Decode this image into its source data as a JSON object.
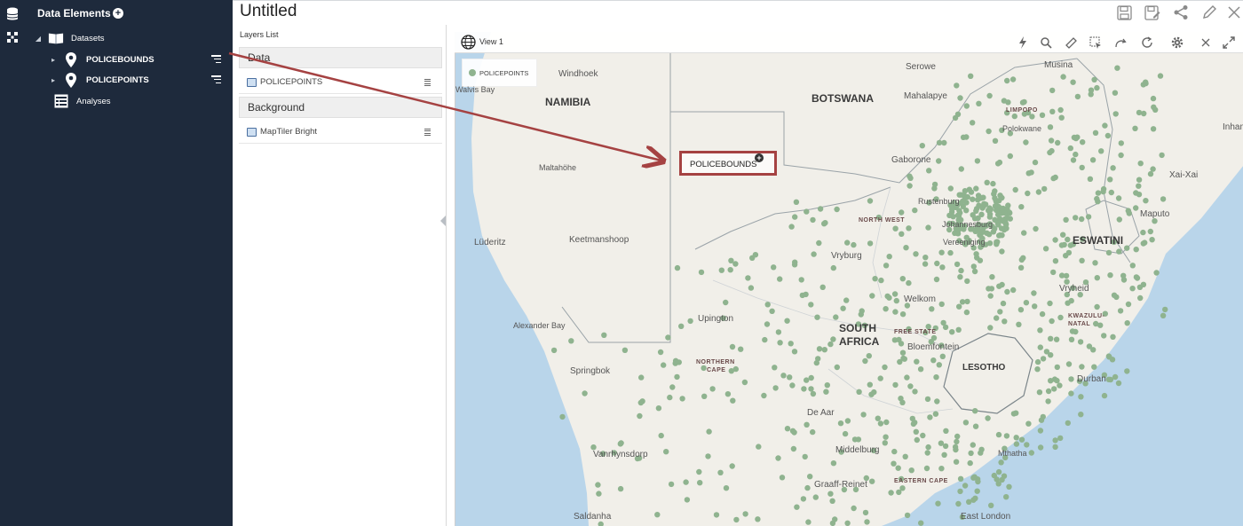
{
  "app": {
    "title": "Untitled"
  },
  "left_panel": {
    "title": "Data Elements",
    "add_icon": "plus-circle-icon",
    "datasets": {
      "label": "Datasets",
      "items": [
        {
          "label": "POLICEBOUNDS",
          "icon": "map-pin-icon"
        },
        {
          "label": "POLICEPOINTS",
          "icon": "map-pin-icon"
        }
      ]
    },
    "analyses": {
      "label": "Analyses"
    },
    "rail_icons": [
      "database-icon",
      "network-icon"
    ]
  },
  "toolbar": {
    "buttons": [
      "save-icon",
      "save-as-icon",
      "share-icon",
      "edit-icon",
      "close-icon"
    ]
  },
  "layers_panel": {
    "title": "Layers List",
    "groups": [
      {
        "label": "Data",
        "layers": [
          {
            "label": "POLICEPOINTS"
          }
        ]
      },
      {
        "label": "Background",
        "layers": [
          {
            "label": "MapTiler Bright"
          }
        ]
      }
    ]
  },
  "map_view": {
    "title": "View 1",
    "tools": [
      "lightning-icon",
      "search-icon",
      "ruler-icon",
      "select-icon",
      "redo-icon",
      "refresh-icon",
      "gear-icon",
      "close-icon",
      "expand-icon"
    ],
    "legend": {
      "label": "POLICEPOINTS",
      "color": "#8fb38f"
    },
    "callout": {
      "label": "POLICEBOUNDS"
    },
    "labels": {
      "countries": [
        "NAMIBIA",
        "BOTSWANA",
        "SOUTH\nAFRICA",
        "LESOTHO",
        "ESWATINI"
      ],
      "south_africa_line1": "SOUTH",
      "south_africa_line2": "AFRICA",
      "provinces": [
        "NORTH WEST",
        "FREE STATE",
        "NORTHERN",
        "CAPE",
        "EASTERN CAPE",
        "KWAZULU-",
        "NATAL",
        "LIMPOPO"
      ],
      "cities": [
        "Windhoek",
        "Maltahöhe",
        "Lüderitz",
        "Keetmanshoop",
        "Alexander Bay",
        "Springbok",
        "Upington",
        "Vryburg",
        "Gaborone",
        "Serowe",
        "Mahalapye",
        "Musina",
        "Polokwane",
        "Rustenburg",
        "Johannesburg",
        "Vereeniging",
        "Welkom",
        "Bloemfontein",
        "De Aar",
        "Middelburg",
        "Graaff-Reinet",
        "Vanrhynsdorp",
        "Saldanha",
        "East London",
        "Mthatha",
        "Durban",
        "Vryheid",
        "Xai-Xai",
        "Maputo",
        "Inhambane",
        "Walvis Bay"
      ]
    },
    "colors": {
      "land": "#f1efe9",
      "water": "#b9d5ea",
      "points": "#8fb38f",
      "borders": "#9aa3a8",
      "arrow": "#a54242"
    }
  }
}
